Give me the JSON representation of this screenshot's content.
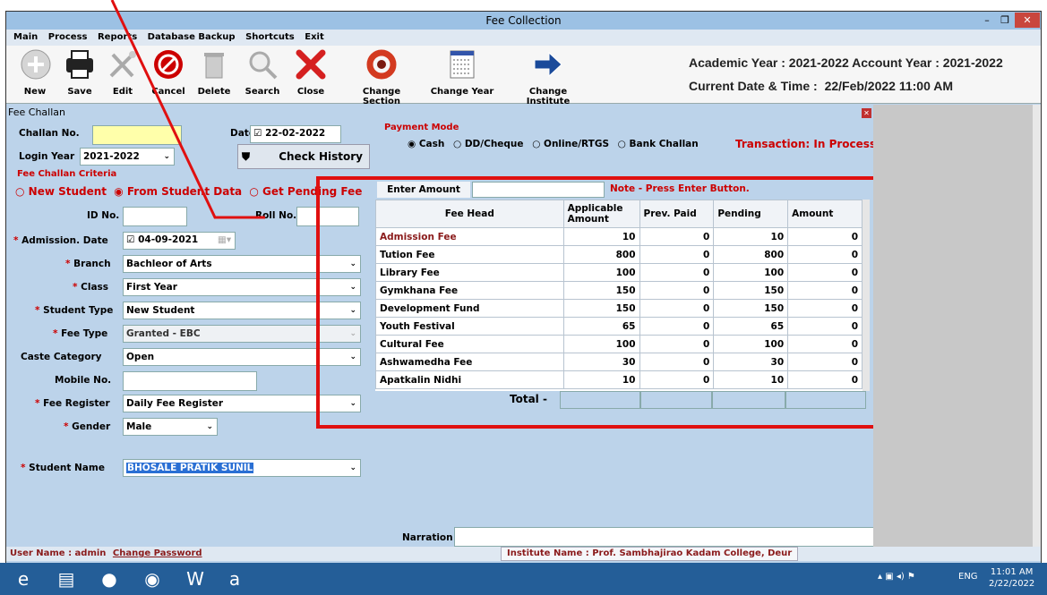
{
  "window": {
    "title": "Fee Collection"
  },
  "menu": [
    "Main",
    "Process",
    "Reports",
    "Database Backup",
    "Shortcuts",
    "Exit"
  ],
  "toolbar": [
    {
      "label": "New",
      "icon": "add-icon"
    },
    {
      "label": "Save",
      "icon": "printer-icon"
    },
    {
      "label": "Edit",
      "icon": "tools-icon"
    },
    {
      "label": "Cancel",
      "icon": "cancel-icon"
    },
    {
      "label": "Delete",
      "icon": "trash-icon"
    },
    {
      "label": "Search",
      "icon": "magnifier-icon"
    },
    {
      "label": "Close",
      "icon": "close-icon"
    },
    {
      "label": "Change Section",
      "icon": "refresh-icon"
    },
    {
      "label": "Change Year",
      "icon": "calendar-icon"
    },
    {
      "label": "Change Institute",
      "icon": "arrow-icon"
    }
  ],
  "year_info": {
    "line1": "Academic Year : 2021-2022 Account Year : 2021-2022",
    "line2_label": "Current Date & Time :",
    "line2_value": "22/Feb/2022 11:00 AM"
  },
  "form": {
    "panel_title": "Fee Challan",
    "challan_label": "Challan No.",
    "challan_value": "",
    "date_label": "Date",
    "date_value": "22-02-2022",
    "login_year_label": "Login Year",
    "login_year_value": "2021-2022",
    "check_history": "Check History",
    "criteria_label": "Fee Challan Criteria",
    "radio_new": "New Student",
    "radio_from": "From Student Data",
    "radio_pending": "Get Pending Fee",
    "id_label": "ID No.",
    "roll_label": "Roll No.",
    "adm_date_label": "Admission. Date",
    "adm_date_value": "04-09-2021",
    "branch_label": "Branch",
    "branch_value": "Bachleor of Arts",
    "class_label": "Class",
    "class_value": "First Year",
    "stype_label": "Student Type",
    "stype_value": "New Student",
    "ftype_label": "Fee Type",
    "ftype_value": "Granted - EBC",
    "caste_label": "Caste Category",
    "caste_value": "Open",
    "mobile_label": "Mobile No.",
    "register_label": "Fee Register",
    "register_value": "Daily Fee Register",
    "gender_label": "Gender",
    "gender_value": "Male",
    "sname_label": "Student Name",
    "sname_value": "BHOSALE PRATIK SUNIL"
  },
  "payment": {
    "label": "Payment Mode",
    "modes": [
      "Cash",
      "DD/Cheque",
      "Online/RTGS",
      "Bank Challan"
    ],
    "transaction_label": "Transaction:",
    "transaction_value": "In Process"
  },
  "amount": {
    "label": "Enter Amount",
    "note": "Note - Press Enter Button."
  },
  "table": {
    "headers": [
      "Fee Head",
      "Applicable Amount",
      "Prev. Paid",
      "Pending",
      "Amount"
    ],
    "rows": [
      [
        "Admission Fee",
        "10",
        "0",
        "10",
        "0"
      ],
      [
        "Tution Fee",
        "800",
        "0",
        "800",
        "0"
      ],
      [
        "Library Fee",
        "100",
        "0",
        "100",
        "0"
      ],
      [
        "Gymkhana Fee",
        "150",
        "0",
        "150",
        "0"
      ],
      [
        "Development Fund",
        "150",
        "0",
        "150",
        "0"
      ],
      [
        "Youth Festival",
        "65",
        "0",
        "65",
        "0"
      ],
      [
        "Cultural Fee",
        "100",
        "0",
        "100",
        "0"
      ],
      [
        "Ashwamedha Fee",
        "30",
        "0",
        "30",
        "0"
      ],
      [
        "Apatkalin Nidhi",
        "10",
        "0",
        "10",
        "0"
      ]
    ],
    "total_label": "Total -"
  },
  "narration_label": "Narration",
  "status": {
    "user": "User Name : admin",
    "change_pw": "Change Password",
    "institute": "Institute Name : Prof. Sambhajirao Kadam College, Deur"
  },
  "tray": {
    "lang": "ENG",
    "time": "11:01 AM",
    "date": "2/22/2022"
  },
  "colors": {
    "highlight": "#e01010",
    "accent": "#c00000"
  }
}
